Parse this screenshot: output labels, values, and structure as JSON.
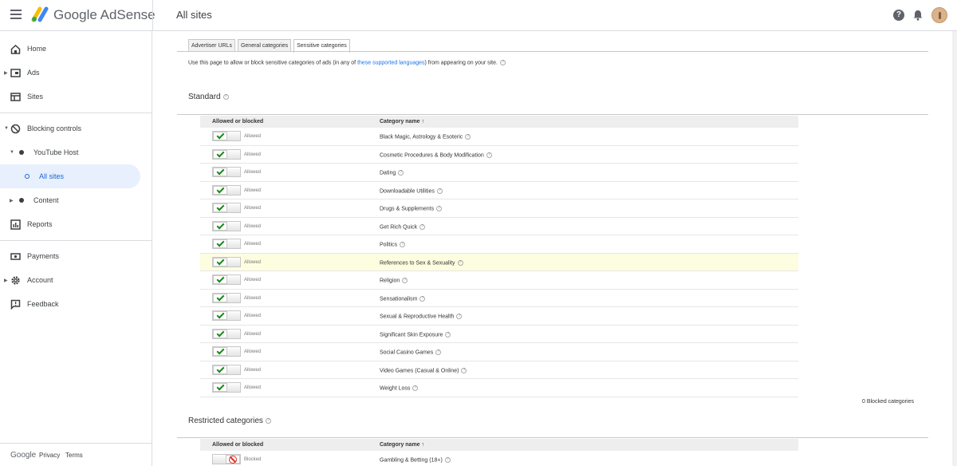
{
  "app": {
    "brand": "Google AdSense",
    "page_title": "All sites"
  },
  "sidebar": {
    "items": [
      {
        "label": "Home"
      },
      {
        "label": "Ads"
      },
      {
        "label": "Sites"
      },
      {
        "label": "Blocking controls"
      },
      {
        "label": "YouTube Host"
      },
      {
        "label": "All sites"
      },
      {
        "label": "Content"
      },
      {
        "label": "Reports"
      },
      {
        "label": "Payments"
      },
      {
        "label": "Account"
      },
      {
        "label": "Feedback"
      }
    ],
    "footer": {
      "google": "Google",
      "privacy": "Privacy",
      "terms": "Terms"
    }
  },
  "tabs": [
    {
      "label": "Advertiser URLs"
    },
    {
      "label": "General categories"
    },
    {
      "label": "Sensitive categories",
      "active": true
    }
  ],
  "intro": {
    "before": "Use this page to allow or block sensitive categories of ads (in any of ",
    "link": "these supported languages",
    "after": ") from appearing on your site."
  },
  "standard": {
    "title": "Standard",
    "col_state": "Allowed or blocked",
    "col_name": "Category name ↑",
    "rows": [
      {
        "state": "Allowed",
        "name": "Black Magic, Astrology & Esoteric"
      },
      {
        "state": "Allowed",
        "name": "Cosmetic Procedures & Body Modification"
      },
      {
        "state": "Allowed",
        "name": "Dating"
      },
      {
        "state": "Allowed",
        "name": "Downloadable Utilities"
      },
      {
        "state": "Allowed",
        "name": "Drugs & Supplements"
      },
      {
        "state": "Allowed",
        "name": "Get Rich Quick"
      },
      {
        "state": "Allowed",
        "name": "Politics"
      },
      {
        "state": "Allowed",
        "name": "References to Sex & Sexuality"
      },
      {
        "state": "Allowed",
        "name": "Religion"
      },
      {
        "state": "Allowed",
        "name": "Sensationalism"
      },
      {
        "state": "Allowed",
        "name": "Sexual & Reproductive Health"
      },
      {
        "state": "Allowed",
        "name": "Significant Skin Exposure"
      },
      {
        "state": "Allowed",
        "name": "Social Casino Games"
      },
      {
        "state": "Allowed",
        "name": "Video Games (Casual & Online)"
      },
      {
        "state": "Allowed",
        "name": "Weight Loss"
      }
    ],
    "blocked_count": "0 Blocked categories"
  },
  "restricted": {
    "title": "Restricted categories",
    "col_state": "Allowed or blocked",
    "col_name": "Category name ↑",
    "rows": [
      {
        "state": "Blocked",
        "name": "Gambling & Betting (18+)"
      }
    ]
  }
}
